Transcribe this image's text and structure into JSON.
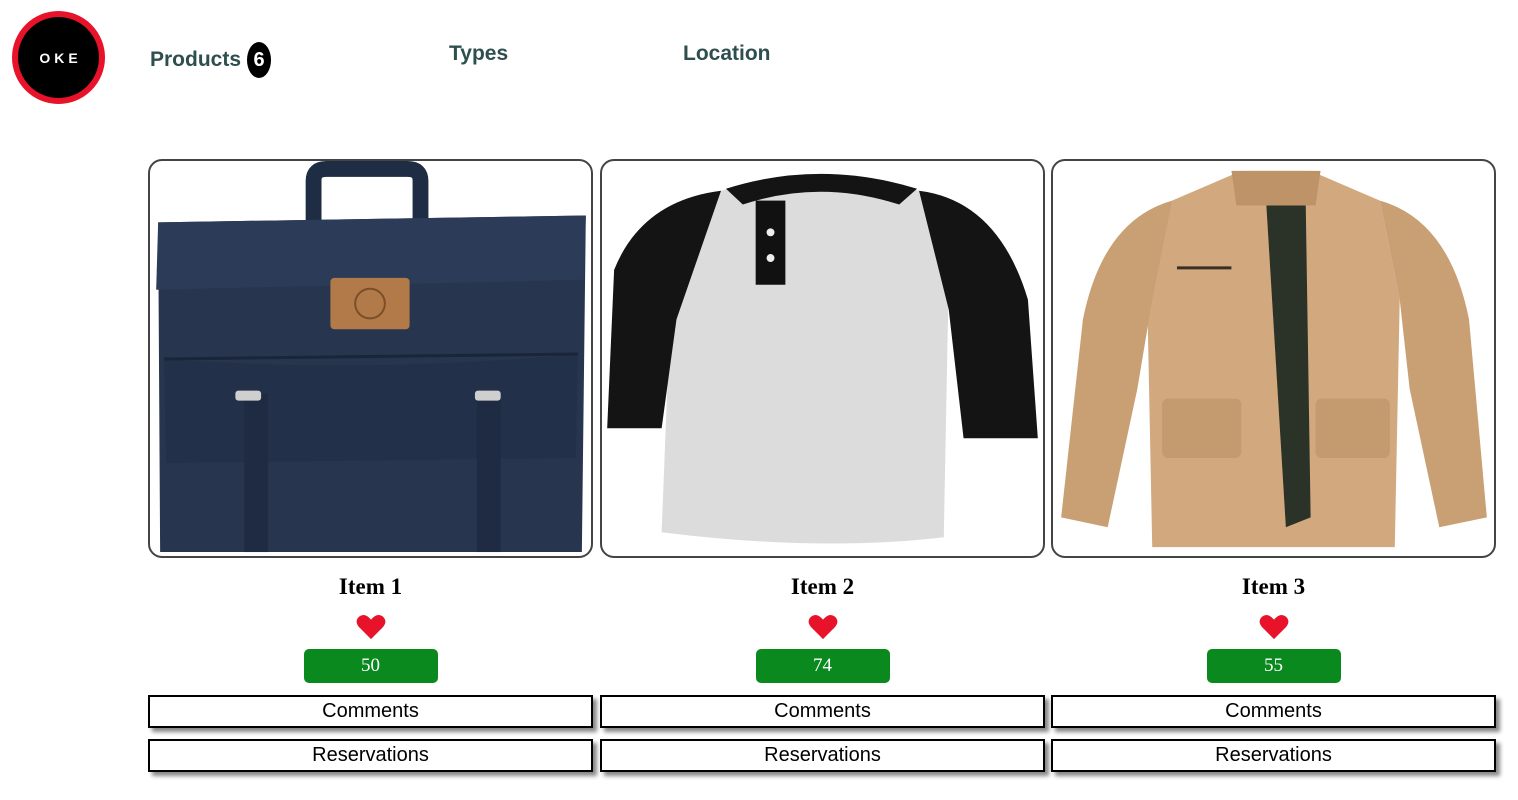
{
  "header": {
    "logo_text": "OKE",
    "nav": {
      "products_label": "Products",
      "products_count": "6",
      "types_label": "Types",
      "location_label": "Location"
    }
  },
  "items": [
    {
      "title": "Item 1",
      "image_name": "navy-backpack-image",
      "likes": "50",
      "comments_label": "Comments",
      "reservations_label": "Reservations"
    },
    {
      "title": "Item 2",
      "image_name": "raglan-henley-shirt-image",
      "likes": "74",
      "comments_label": "Comments",
      "reservations_label": "Reservations"
    },
    {
      "title": "Item 3",
      "image_name": "khaki-jacket-image",
      "likes": "55",
      "comments_label": "Comments",
      "reservations_label": "Reservations"
    }
  ],
  "colors": {
    "logo_ring": "#e8132b",
    "nav_text": "#2f4f4f",
    "like_heart": "#e8132b",
    "like_badge": "#0a8a1e"
  },
  "icons": {
    "like": "heart-icon"
  }
}
